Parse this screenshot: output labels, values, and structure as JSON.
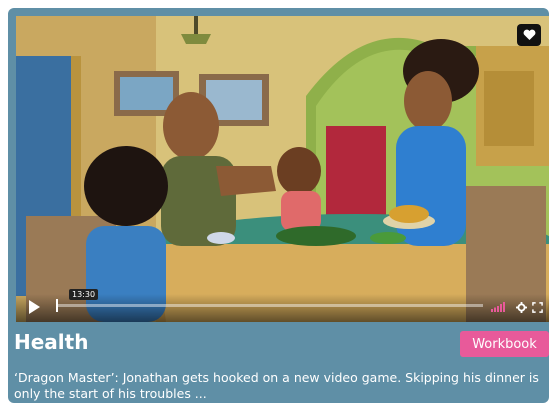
{
  "video": {
    "timestamp": "13:30",
    "progress": 0,
    "favorite_icon": "heart-icon",
    "play_icon": "play-icon",
    "volume_icon": "volume-bars-icon",
    "settings_icon": "gear-icon",
    "fullscreen_icon": "fullscreen-icon"
  },
  "episode": {
    "title": "Health",
    "workbook_label": "Workbook",
    "description_line1": "‘Dragon Master’: Jonathan gets hooked on a new video game. Skipping his dinner is",
    "description_line2": "only the start of his troubles ..."
  },
  "colors": {
    "card_background": "#5f8fa6",
    "workbook_button": "#e85a9a"
  }
}
